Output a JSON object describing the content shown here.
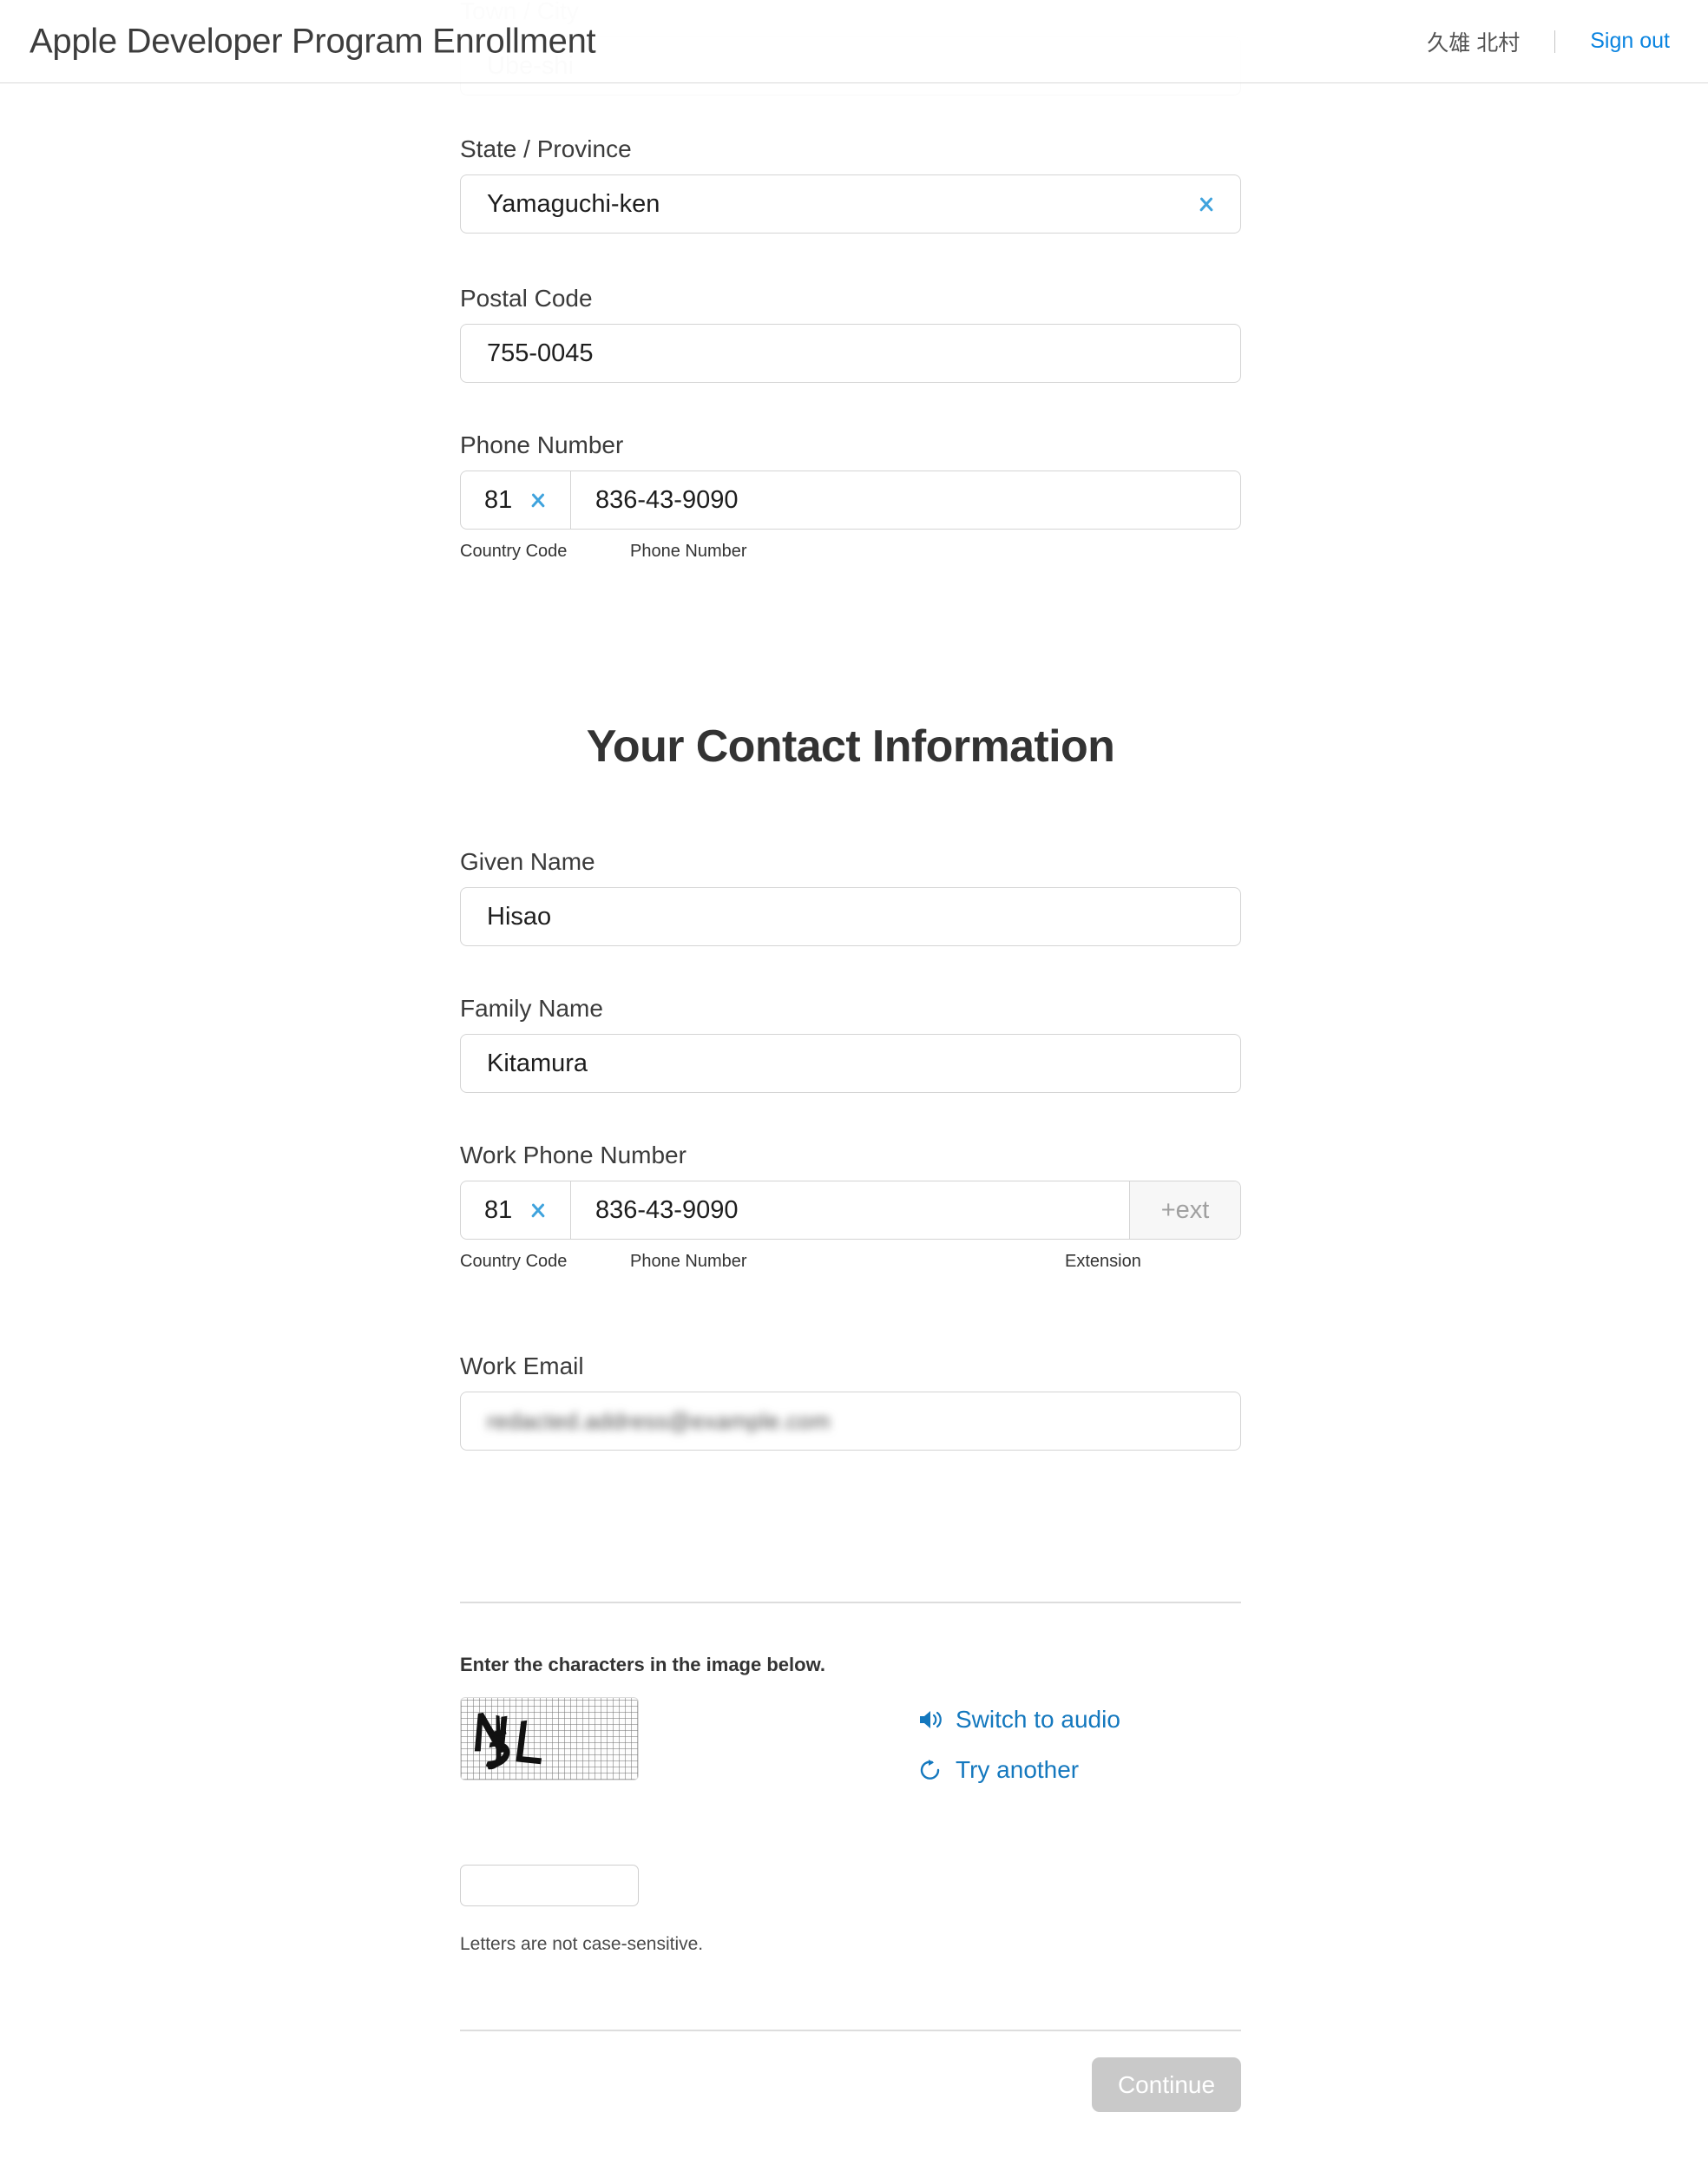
{
  "header": {
    "title": "Apple Developer Program Enrollment",
    "user_name": "久雄 北村",
    "sign_out_label": "Sign out"
  },
  "scrolled_under": {
    "label": "Town / City",
    "value": "Ube-shi"
  },
  "address_section": {
    "state_province": {
      "label": "State / Province",
      "value": "Yamaguchi-ken"
    },
    "postal_code": {
      "label": "Postal Code",
      "value": "755-0045"
    },
    "phone": {
      "label": "Phone Number",
      "country_code": "81",
      "number": "836-43-9090",
      "helper_country_code": "Country Code",
      "helper_phone_number": "Phone Number"
    }
  },
  "contact_section": {
    "heading": "Your Contact Information",
    "given_name": {
      "label": "Given Name",
      "value": "Hisao"
    },
    "family_name": {
      "label": "Family Name",
      "value": "Kitamura"
    },
    "work_phone": {
      "label": "Work Phone Number",
      "country_code": "81",
      "number": "836-43-9090",
      "extension_placeholder": "+ext",
      "helper_country_code": "Country Code",
      "helper_phone_number": "Phone Number",
      "helper_extension": "Extension"
    },
    "work_email": {
      "label": "Work Email",
      "value": "redacted.address@example.com"
    }
  },
  "captcha": {
    "instruction": "Enter the characters in the image below.",
    "image_characters": "NbL",
    "switch_to_audio_label": "Switch to audio",
    "try_another_label": "Try another",
    "input_value": "",
    "note": "Letters are not case-sensitive."
  },
  "footer": {
    "continue_label": "Continue"
  },
  "colors": {
    "link_blue": "#0a84e0",
    "captcha_link_blue": "#1478be",
    "chevron_blue": "#3fa3dd",
    "text_dark": "#333333",
    "border_gray": "#d4d4d4",
    "disabled_button": "#c9c9c9"
  }
}
